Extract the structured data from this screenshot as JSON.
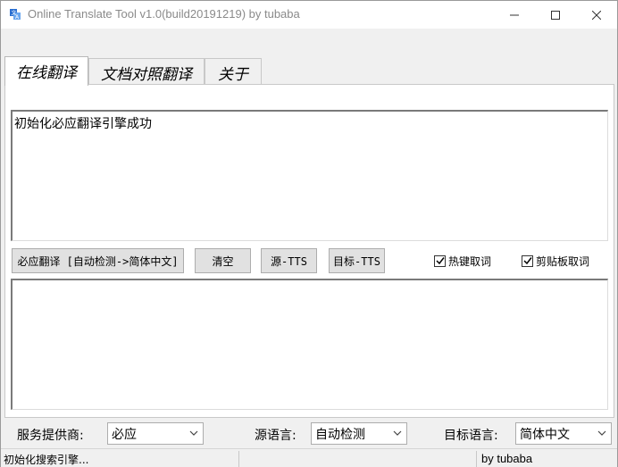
{
  "window": {
    "title": "Online Translate Tool v1.0(build20191219) by tubaba",
    "icons": {
      "app": "translate-app-icon",
      "minimize": "minimize-icon",
      "maximize": "maximize-icon",
      "close": "close-icon"
    }
  },
  "tabs": [
    {
      "label": "在线翻译",
      "active": true
    },
    {
      "label": "文档对照翻译",
      "active": false
    },
    {
      "label": "关于",
      "active": false
    }
  ],
  "source_text": "初始化必应翻译引擎成功",
  "target_text": "",
  "buttons": {
    "translate": "必应翻译 [自动检测->简体中文]",
    "clear": "清空",
    "source_tts": "源-TTS",
    "target_tts": "目标-TTS"
  },
  "checkboxes": {
    "hotkey": {
      "label": "热键取词",
      "checked": true
    },
    "clipboard": {
      "label": "剪贴板取词",
      "checked": true
    }
  },
  "selectors": {
    "provider": {
      "label": "服务提供商:",
      "value": "必应"
    },
    "source_lang": {
      "label": "源语言:",
      "value": "自动检测"
    },
    "target_lang": {
      "label": "目标语言:",
      "value": "简体中文"
    }
  },
  "status": {
    "left": "初始化搜索引擎...",
    "right": "by tubaba"
  },
  "colors": {
    "titlebar": "#ffffff",
    "window_bg": "#f0f0f0",
    "button_bg": "#e1e1e1"
  }
}
